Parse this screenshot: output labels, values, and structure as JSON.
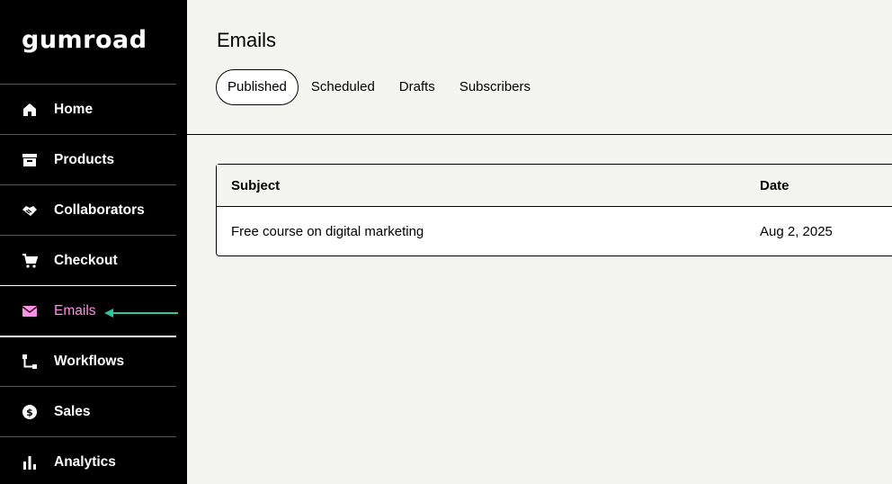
{
  "brand": {
    "logo_text": "gumroad",
    "accent": "#ff90e8",
    "arrow_color": "#2ec4a0"
  },
  "sidebar": {
    "items": [
      {
        "label": "Home",
        "icon": "home-icon"
      },
      {
        "label": "Products",
        "icon": "archive-box-icon"
      },
      {
        "label": "Collaborators",
        "icon": "handshake-icon"
      },
      {
        "label": "Checkout",
        "icon": "cart-icon"
      },
      {
        "label": "Emails",
        "icon": "envelope-icon",
        "active": true
      },
      {
        "label": "Workflows",
        "icon": "workflow-icon"
      },
      {
        "label": "Sales",
        "icon": "dollar-circle-icon"
      },
      {
        "label": "Analytics",
        "icon": "bar-chart-icon"
      }
    ]
  },
  "header": {
    "title": "Emails",
    "tabs": [
      {
        "label": "Published",
        "active": true
      },
      {
        "label": "Scheduled"
      },
      {
        "label": "Drafts"
      },
      {
        "label": "Subscribers"
      }
    ]
  },
  "table": {
    "columns": [
      "Subject",
      "Date"
    ],
    "rows": [
      {
        "subject": "Free course on digital marketing",
        "date": "Aug 2, 2025"
      }
    ]
  }
}
